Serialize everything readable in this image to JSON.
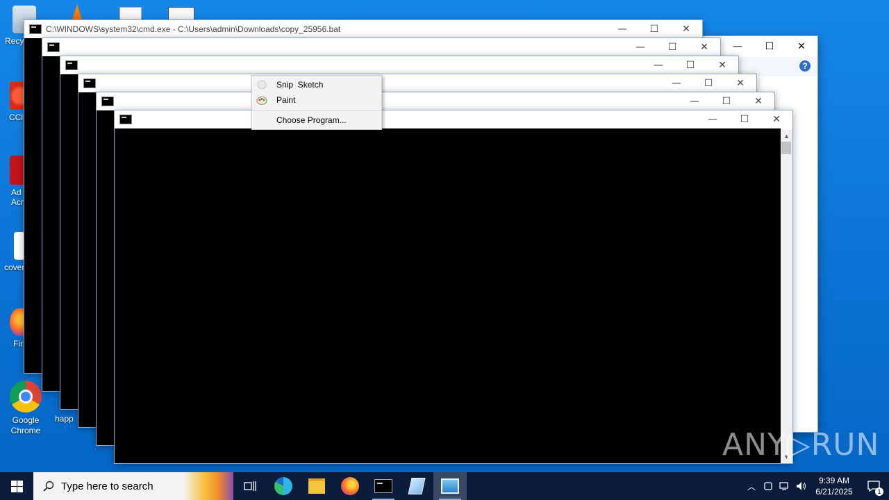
{
  "desktop": {
    "icons": [
      {
        "label": "Recy"
      },
      {
        "label": "CCl"
      },
      {
        "label": "Ad Acr"
      },
      {
        "label": "cover"
      },
      {
        "label": "Fir"
      },
      {
        "label": "Google Chrome"
      },
      {
        "label": "happ"
      }
    ]
  },
  "windows": {
    "cmd_main_title": "C:\\WINDOWS\\system32\\cmd.exe - C:\\Users\\admin\\Downloads\\copy_25956.bat",
    "minimize_glyph": "—",
    "maximize_glyph": "☐",
    "close_glyph": "✕"
  },
  "context_menu": {
    "items": [
      {
        "label": "Snip  Sketch",
        "icon": "snip-sketch-icon"
      },
      {
        "label": "Paint",
        "icon": "paint-icon"
      },
      {
        "label": "Choose Program...",
        "icon": ""
      }
    ]
  },
  "watermark": {
    "text": "ANY▷RUN"
  },
  "taskbar": {
    "search_placeholder": "Type here to search",
    "apps": [
      {
        "name": "task-view"
      },
      {
        "name": "edge"
      },
      {
        "name": "file-explorer"
      },
      {
        "name": "firefox"
      },
      {
        "name": "cmd"
      },
      {
        "name": "notepad"
      },
      {
        "name": "photos"
      }
    ],
    "clock_time": "9:39 AM",
    "clock_date": "6/21/2025",
    "notification_count": "1"
  },
  "colors": {
    "desktop": "#0b74d6",
    "taskbar": "#0c1d3b",
    "console": "#000000"
  }
}
